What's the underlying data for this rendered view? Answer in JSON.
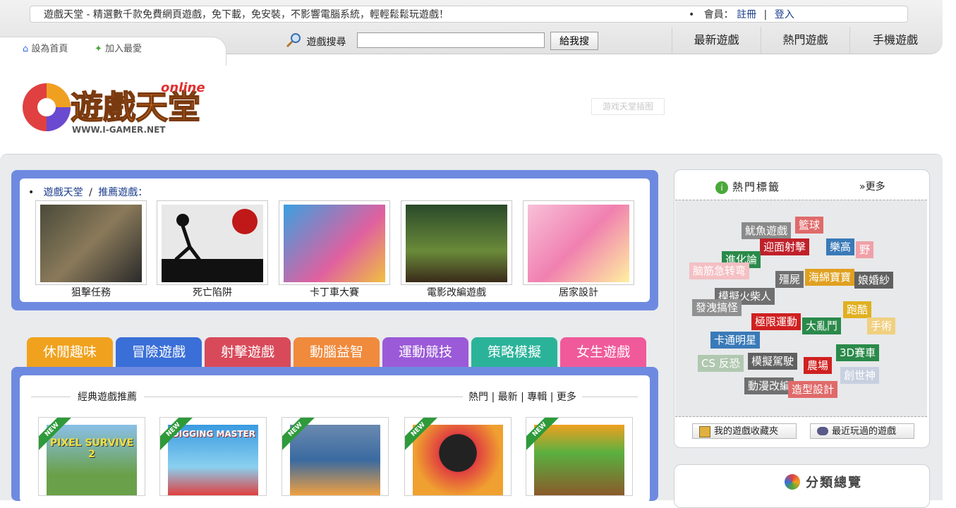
{
  "header": {
    "slogan": "遊戲天堂 - 精選數千款免費網頁遊戲，免下載，免安裝，不影響電腦系統，輕輕鬆鬆玩遊戲！",
    "member_label": "會員：",
    "register": "註冊",
    "separator": "|",
    "login": "登入",
    "set_home": "設為首頁",
    "add_favorite": "加入最愛",
    "search_label": "遊戲搜尋",
    "search_value": "",
    "search_button": "給我搜",
    "nav": [
      "最新遊戲",
      "熱門遊戲",
      "手機遊戲"
    ]
  },
  "logo": {
    "main_text": "遊戲天堂",
    "sub_text": "online",
    "url_text": "WWW.I-GAMER.NET"
  },
  "ad_placeholder": "游戏天堂插图",
  "recommended": {
    "breadcrumb_home": "遊戲天堂",
    "breadcrumb_sep": "/",
    "breadcrumb_current": "推薦遊戲：",
    "games": [
      "狙擊任務",
      "死亡陷阱",
      "卡丁車大賽",
      "電影改編遊戲",
      "居家設計"
    ]
  },
  "categories": [
    {
      "label": "休閒趣味",
      "color": "#f0a21e"
    },
    {
      "label": "冒險遊戲",
      "color": "#3a6fd8"
    },
    {
      "label": "射擊遊戲",
      "color": "#d84a5a"
    },
    {
      "label": "動腦益智",
      "color": "#f08a3c"
    },
    {
      "label": "運動競技",
      "color": "#9b5ad8"
    },
    {
      "label": "策略模擬",
      "color": "#2bb39a"
    },
    {
      "label": "女生遊戲",
      "color": "#f05a9a"
    }
  ],
  "classic": {
    "title": "經典遊戲推薦",
    "links": [
      "熱門",
      "最新",
      "專輯",
      "更多"
    ],
    "new_tag": "NEW",
    "thumb_texts": [
      "PIXEL SURVIVE 2",
      "DIGGING MASTER"
    ]
  },
  "hot_tags": {
    "title": "熱門標籤",
    "more": "»更多",
    "tags": [
      {
        "text": "魷魚遊戲",
        "color": "#8a8a8a"
      },
      {
        "text": "籃球",
        "color": "#e06a6a"
      },
      {
        "text": "迎面射擊",
        "color": "#c0202a"
      },
      {
        "text": "樂高",
        "color": "#3a7ab8"
      },
      {
        "text": "野",
        "color": "#f0a0a8"
      },
      {
        "text": "進化論",
        "color": "#2a8a4a"
      },
      {
        "text": "脑筋急转弯",
        "color": "#f4c0c4"
      },
      {
        "text": "殭屍",
        "color": "#707070"
      },
      {
        "text": "海綿寶寶",
        "color": "#e0a020"
      },
      {
        "text": "娘婚紗",
        "color": "#606060"
      },
      {
        "text": "模擬火柴人",
        "color": "#707070"
      },
      {
        "text": "發洩搞怪",
        "color": "#909090"
      },
      {
        "text": "跑酷",
        "color": "#e0b020"
      },
      {
        "text": "極限運動",
        "color": "#d02020"
      },
      {
        "text": "大亂鬥",
        "color": "#2a8a4a"
      },
      {
        "text": "手術",
        "color": "#f0d080"
      },
      {
        "text": "卡通明星",
        "color": "#3a7ab8"
      },
      {
        "text": "3D賽車",
        "color": "#2a8a4a"
      },
      {
        "text": "CS 反恐",
        "color": "#b0c8b0"
      },
      {
        "text": "模擬駕駛",
        "color": "#606060"
      },
      {
        "text": "農場",
        "color": "#d02020"
      },
      {
        "text": "創世神",
        "color": "#c8d0e0"
      },
      {
        "text": "動漫改編",
        "color": "#707070"
      },
      {
        "text": "造型設計",
        "color": "#e06a6a"
      }
    ],
    "buttons": [
      "我的遊戲收藏夾",
      "最近玩過的遊戲"
    ]
  },
  "category_overview": {
    "title": "分類總覽"
  }
}
